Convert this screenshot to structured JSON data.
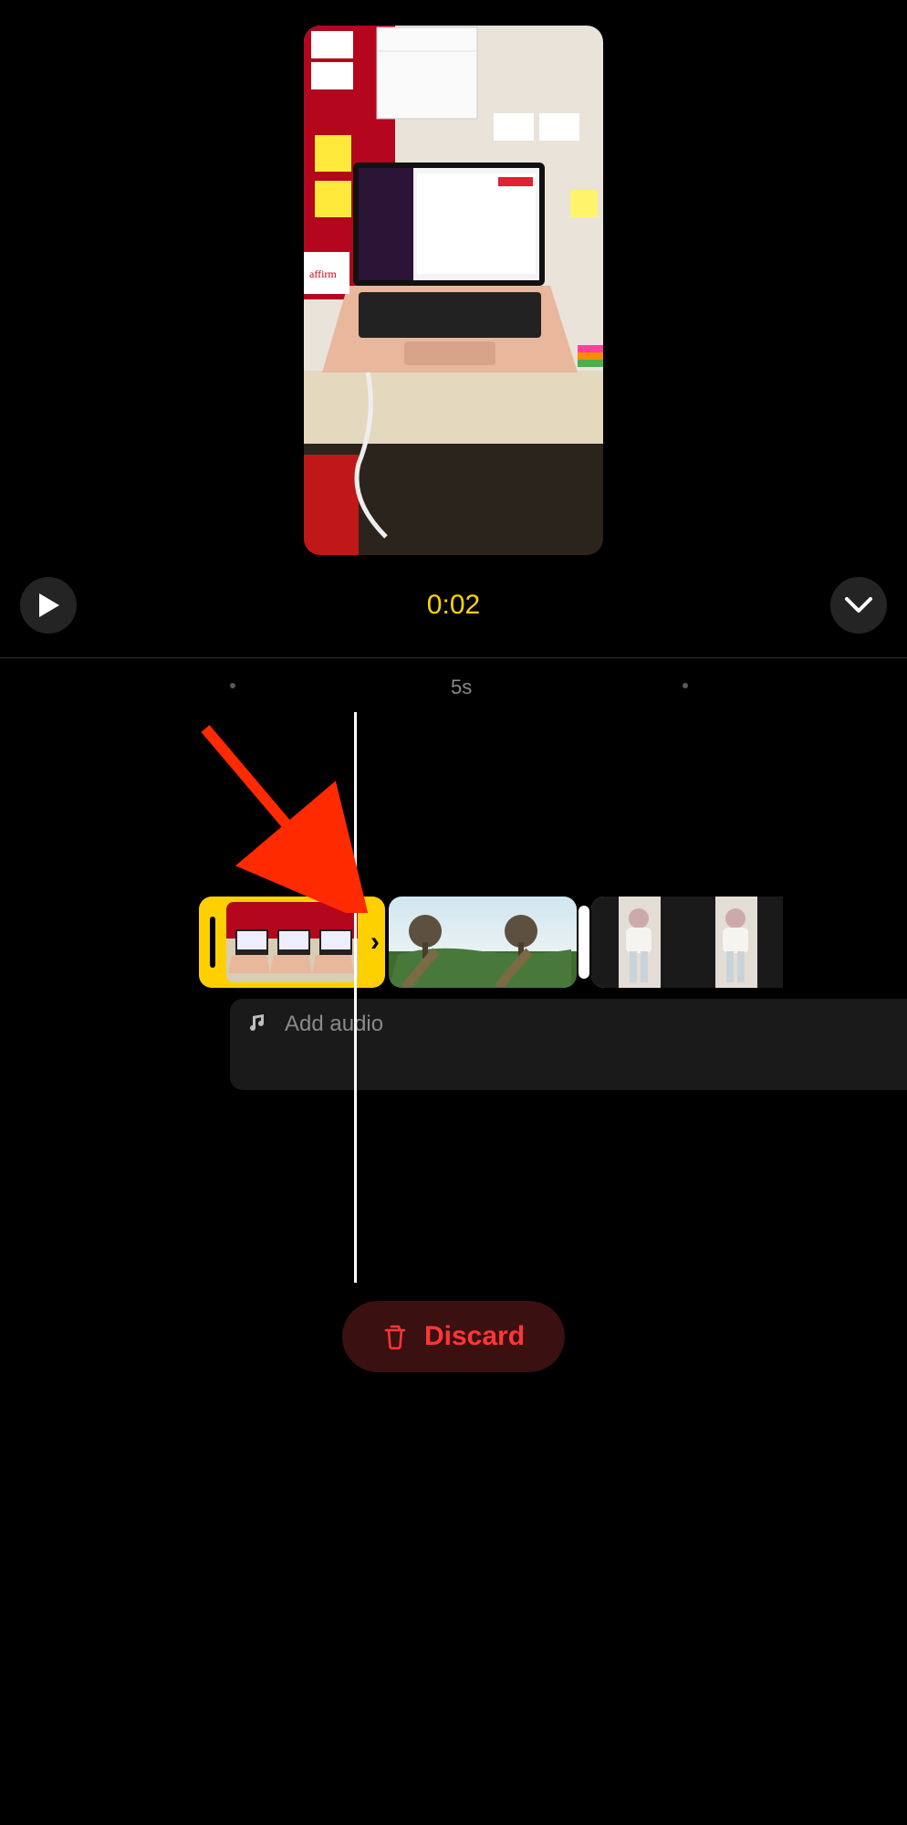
{
  "preview": {
    "description": "Desk with open laptop on stand, red pinboard with sticky notes and calendar behind"
  },
  "playback": {
    "time_label": "0:02"
  },
  "ruler": {
    "marker_label": "5s"
  },
  "timeline": {
    "clips": [
      {
        "id": "clip-1",
        "selected": true,
        "desc": "laptop desk clip"
      },
      {
        "id": "clip-2",
        "selected": false,
        "desc": "outdoor tree path clip"
      },
      {
        "id": "clip-3",
        "selected": false,
        "desc": "person in changing room clip"
      }
    ]
  },
  "audio": {
    "add_label": "Add audio"
  },
  "actions": {
    "discard_label": "Discard"
  },
  "icons": {
    "play": "play-icon",
    "collapse": "chevron-down-icon",
    "music": "music-note-icon",
    "trash": "trash-icon"
  },
  "annotation": {
    "type": "arrow",
    "color": "#ff2a00",
    "points_to": "end of selected clip / playhead"
  }
}
